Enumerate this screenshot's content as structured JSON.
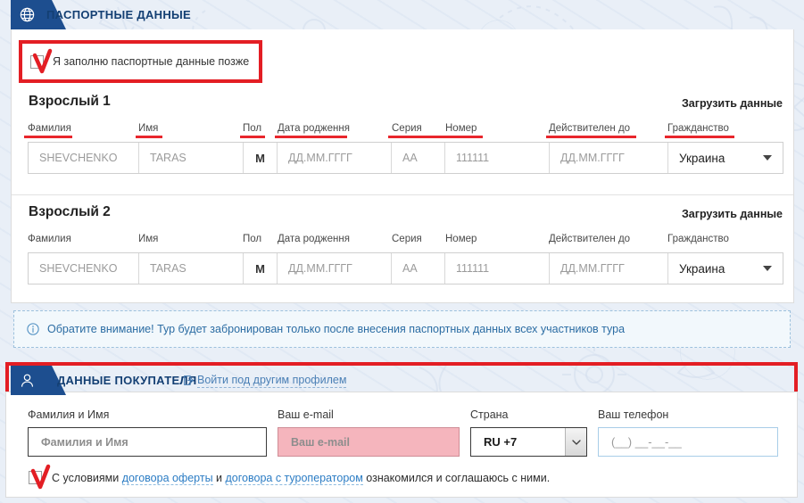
{
  "passport_section": {
    "tab_icon": "globe-icon",
    "title": "ПАСПОРТНЫЕ ДАННЫЕ",
    "later_checkbox_label": "Я заполню паспортные данные позже",
    "later_checkbox_checked": true,
    "upload_label": "Загрузить данные",
    "columns": [
      {
        "label": "Фамилия",
        "underlined": true
      },
      {
        "label": "Имя",
        "underlined": true
      },
      {
        "label": "Пол",
        "underlined": true
      },
      {
        "label": "Дата родження",
        "underlined": true
      },
      {
        "label": "Серия",
        "underlined": true
      },
      {
        "label": "Номер",
        "underlined": true
      },
      {
        "label": "Действителен до",
        "underlined": true
      },
      {
        "label": "Гражданство",
        "underlined": true
      }
    ],
    "travellers": [
      {
        "title": "Взрослый 1",
        "upload_label": "Загрузить данные",
        "values": {
          "surname": "SHEVCHENKO",
          "name": "TARAS",
          "gender": "M",
          "birthdate": "ДД.ММ.ГГГГ",
          "series": "AA",
          "number": "111111",
          "valid_until": "ДД.ММ.ГГГГ",
          "citizenship": "Украина"
        }
      },
      {
        "title": "Взрослый 2",
        "upload_label": "Загрузить данные",
        "values": {
          "surname": "SHEVCHENKO",
          "name": "TARAS",
          "gender": "M",
          "birthdate": "ДД.ММ.ГГГГ",
          "series": "AA",
          "number": "111111",
          "valid_until": "ДД.ММ.ГГГГ",
          "citizenship": "Украина"
        }
      }
    ],
    "notice": {
      "icon": "info-icon",
      "text": "Обратите внимание! Тур будет забронирован только после внесения паспортных данных всех участников тура"
    }
  },
  "buyer_section": {
    "tab_icon": "user-icon",
    "title": "ДАННЫЕ ПОКУПАТЕЛЯ",
    "relogin_icon": "login-icon",
    "relogin_label": "Войти под другим профилем",
    "fields": {
      "fullname": {
        "label": "Фамилия и Имя",
        "placeholder": "Фамилия и Имя",
        "value": ""
      },
      "email": {
        "label": "Ваш e-mail",
        "placeholder": "Ваш e-mail",
        "value": "",
        "error": true
      },
      "country": {
        "label": "Страна",
        "value": "RU +7"
      },
      "phone": {
        "label": "Ваш телефон",
        "placeholder": "(__) __-__-__",
        "value": ""
      }
    },
    "agreement": {
      "checked": true,
      "prefix": "С условиями ",
      "link1": "договора оферты",
      "middle": " и ",
      "link2": "договора с туроператором",
      "suffix": " ознакомился и соглашаюсь с ними."
    }
  },
  "colors": {
    "brand_blue": "#1d4e8f",
    "highlight_red": "#e31e24",
    "error_pink": "#f5b5bd",
    "link_blue": "#2b7cc4"
  }
}
